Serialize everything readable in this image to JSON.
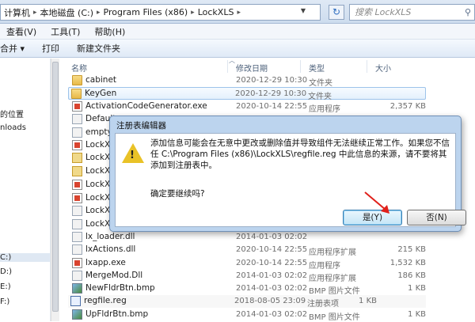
{
  "address": {
    "crumbs": [
      "计算机",
      "本地磁盘 (C:)",
      "Program Files (x86)",
      "LockXLS"
    ],
    "search_placeholder": "搜索 LockXLS"
  },
  "menu": [
    "查看(V)",
    "工具(T)",
    "帮助(H)"
  ],
  "toolbar": [
    "合并 ▾",
    "打印",
    "新建文件夹"
  ],
  "nav": [
    "的位置",
    "nloads",
    "C:)",
    "D:)",
    "E:)",
    "F:)"
  ],
  "columns": {
    "name": "名称",
    "date": "修改日期",
    "type": "类型",
    "size": "大小"
  },
  "files": [
    {
      "name": "cabinet",
      "date": "2020-12-29 10:30",
      "type": "文件夹",
      "size": "",
      "icon": "folder-icon"
    },
    {
      "name": "KeyGen",
      "date": "2020-12-29 10:30",
      "type": "文件夹",
      "size": "",
      "icon": "folder-icon"
    },
    {
      "name": "ActivationCodeGenerator.exe",
      "date": "2020-10-14 22:55",
      "type": "应用程序",
      "size": "2,357 KB",
      "icon": "exe-icon"
    },
    {
      "name": "Default",
      "date": "",
      "type": "",
      "size": "",
      "icon": "file-icon"
    },
    {
      "name": "empty.n",
      "date": "",
      "type": "",
      "size": "",
      "icon": "file-icon"
    },
    {
      "name": "LockXL",
      "date": "",
      "type": "",
      "size": "",
      "icon": "lockxls-icon"
    },
    {
      "name": "LockXL",
      "date": "",
      "type": "",
      "size": "",
      "icon": "lockxls-icon"
    },
    {
      "name": "LockXL",
      "date": "",
      "type": "",
      "size": "",
      "icon": "lockxls-icon"
    },
    {
      "name": "LockXL",
      "date": "",
      "type": "",
      "size": "",
      "icon": "lockxls-icon"
    },
    {
      "name": "LockXL",
      "date": "",
      "type": "",
      "size": "",
      "icon": "lockxls-icon"
    },
    {
      "name": "LockXL",
      "date": "",
      "type": "",
      "size": "",
      "icon": "lockxls-icon"
    },
    {
      "name": "LockXL",
      "date": "",
      "type": "",
      "size": "",
      "icon": "lockxls-icon"
    },
    {
      "name": "lx_loader.dll",
      "date": "2014-01-03 02:02",
      "type": "",
      "size": "",
      "icon": "dll-icon"
    },
    {
      "name": "lxActions.dll",
      "date": "2020-10-14 22:55",
      "type": "应用程序扩展",
      "size": "215 KB",
      "icon": "dll-icon"
    },
    {
      "name": "lxapp.exe",
      "date": "2020-10-14 22:55",
      "type": "应用程序",
      "size": "1,532 KB",
      "icon": "exe-icon"
    },
    {
      "name": "MergeMod.Dll",
      "date": "2014-01-03 02:02",
      "type": "应用程序扩展",
      "size": "186 KB",
      "icon": "dll-icon"
    },
    {
      "name": "NewFldrBtn.bmp",
      "date": "2014-01-03 02:02",
      "type": "BMP 图片文件",
      "size": "1 KB",
      "icon": "bmp-icon"
    },
    {
      "name": "regfile.reg",
      "date": "2018-08-05 23:09",
      "type": "注册表项",
      "size": "1 KB",
      "icon": "reg-icon"
    },
    {
      "name": "UpFldrBtn.bmp",
      "date": "2014-01-03 02:02",
      "type": "BMP 图片文件",
      "size": "1 KB",
      "icon": "bmp-icon"
    }
  ],
  "dialog": {
    "title": "注册表编辑器",
    "message": "添加信息可能会在无意中更改或删除值并导致组件无法继续正常工作。如果您不信任 C:\\Program Files (x86)\\LockXLS\\regfile.reg 中此信息的来源，请不要将其添加到注册表中。",
    "confirm": "确定要继续吗?",
    "yes_label": "是(Y)",
    "no_label": "否(N)"
  },
  "colors": {
    "annotation_arrow": "#e0211b",
    "warning": "#e9c227"
  }
}
